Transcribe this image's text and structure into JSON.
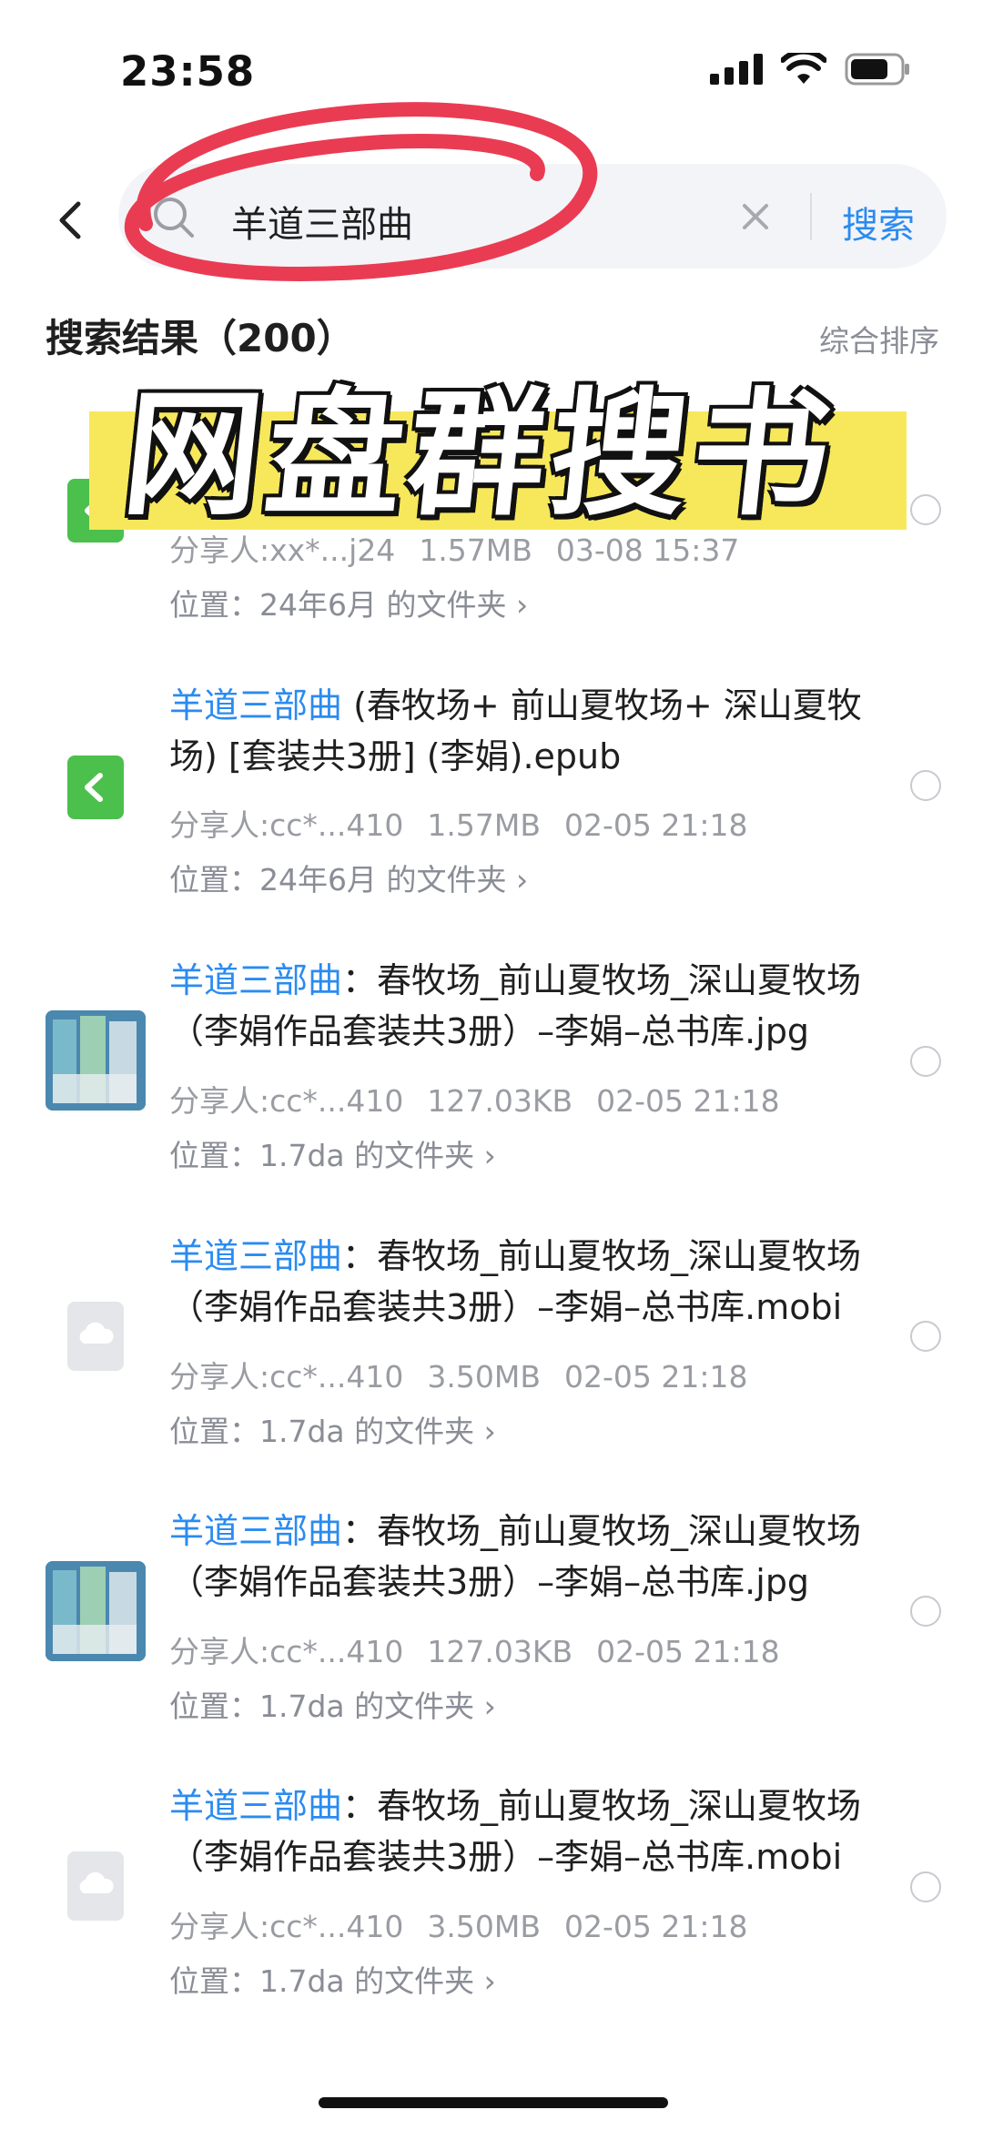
{
  "status": {
    "time": "23:58"
  },
  "search": {
    "query": "羊道三部曲",
    "button": "搜索"
  },
  "results": {
    "title": "搜索结果（200）",
    "sort": "综合排序"
  },
  "banner": {
    "text": "网盘群搜书"
  },
  "items": [
    {
      "icon": "epub-icon",
      "meta_sharer": "分享人:xx*...j24",
      "meta_size": "1.57MB",
      "meta_date": "03-08 15:37",
      "location": "位置：24年6月 的文件夹 ›"
    },
    {
      "icon": "epub-icon",
      "title_hl": "羊道三部曲",
      "title_rest": " (春牧场+ 前山夏牧场+ 深山夏牧场) [套装共3册] (李娟).epub",
      "meta_sharer": "分享人:cc*...410",
      "meta_size": "1.57MB",
      "meta_date": "02-05 21:18",
      "location": "位置：24年6月 的文件夹 ›"
    },
    {
      "icon": "book-cover-icon",
      "title_hl": "羊道三部曲",
      "title_rest": "：春牧场_前山夏牧场_深山夏牧场（李娟作品套装共3册）–李娟–总书库.jpg",
      "meta_sharer": "分享人:cc*...410",
      "meta_size": "127.03KB",
      "meta_date": "02-05 21:18",
      "location": "位置：1.7da 的文件夹 ›"
    },
    {
      "icon": "cloud-file-icon",
      "title_hl": "羊道三部曲",
      "title_rest": "：春牧场_前山夏牧场_深山夏牧场（李娟作品套装共3册）–李娟–总书库.mobi",
      "meta_sharer": "分享人:cc*...410",
      "meta_size": "3.50MB",
      "meta_date": "02-05 21:18",
      "location": "位置：1.7da 的文件夹 ›"
    },
    {
      "icon": "book-cover-icon",
      "title_hl": "羊道三部曲",
      "title_rest": "：春牧场_前山夏牧场_深山夏牧场（李娟作品套装共3册）–李娟–总书库.jpg",
      "meta_sharer": "分享人:cc*...410",
      "meta_size": "127.03KB",
      "meta_date": "02-05 21:18",
      "location": "位置：1.7da 的文件夹 ›"
    },
    {
      "icon": "cloud-file-icon",
      "title_hl": "羊道三部曲",
      "title_rest": "：春牧场_前山夏牧场_深山夏牧场（李娟作品套装共3册）–李娟–总书库.mobi",
      "meta_sharer": "分享人:cc*...410",
      "meta_size": "3.50MB",
      "meta_date": "02-05 21:18",
      "location": "位置：1.7da 的文件夹 ›"
    }
  ],
  "colors": {
    "accent": "#2a8bf0",
    "banner": "#f7e85b",
    "scribble": "#e8324a"
  }
}
